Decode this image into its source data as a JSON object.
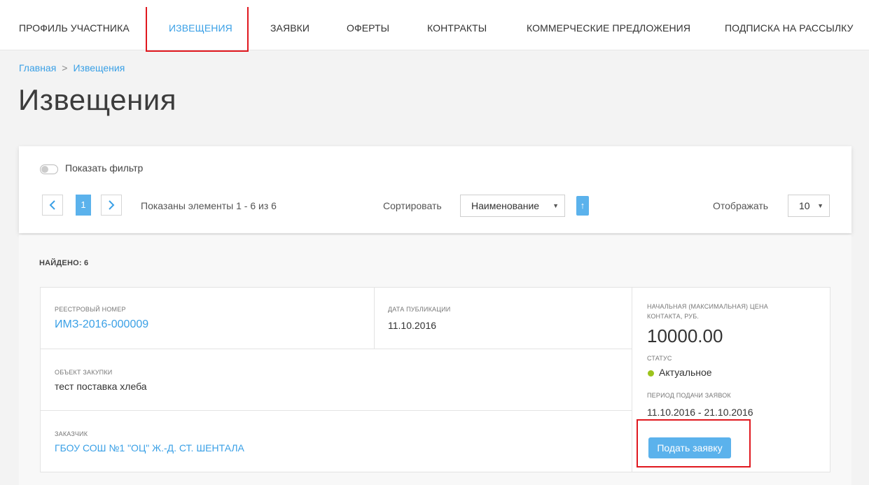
{
  "nav": {
    "items": [
      {
        "label": "ПРОФИЛЬ УЧАСТНИКА"
      },
      {
        "label": "ИЗВЕЩЕНИЯ"
      },
      {
        "label": "ЗАЯВКИ"
      },
      {
        "label": "ОФЕРТЫ"
      },
      {
        "label": "КОНТРАКТЫ"
      },
      {
        "label": "КОММЕРЧЕСКИЕ ПРЕДЛОЖЕНИЯ"
      },
      {
        "label": "ПОДПИСКА НА РАССЫЛКУ"
      }
    ],
    "active_index": 1
  },
  "breadcrumb": {
    "home": "Главная",
    "separator": ">",
    "current": "Извещения"
  },
  "page_title": "Извещения",
  "filter": {
    "toggle_label": "Показать фильтр",
    "toggle_on": false
  },
  "pager": {
    "prev_icon": "chevron-left-icon",
    "next_icon": "chevron-right-icon",
    "current_page": "1",
    "shown_text": "Показаны элементы 1 - 6 из 6"
  },
  "sort": {
    "label": "Сортировать",
    "selected": "Наименование",
    "direction_icon": "arrow-up-icon"
  },
  "display": {
    "label": "Отображать",
    "selected": "10"
  },
  "results": {
    "found_text": "НАЙДЕНО: 6",
    "items": [
      {
        "registry_label": "РЕЕСТРОВЫЙ НОМЕР",
        "registry_number": "ИМЗ-2016-000009",
        "pub_date_label": "ДАТА ПУБЛИКАЦИИ",
        "pub_date": "11.10.2016",
        "object_label": "ОБЪЕКТ ЗАКУПКИ",
        "object": "тест поставка хлеба",
        "customer_label": "ЗАКАЗЧИК",
        "customer": "ГБОУ СОШ №1 \"ОЦ\" Ж.-Д. СТ. ШЕНТАЛА",
        "price_label_line1": "НАЧАЛЬНАЯ (МАКСИМАЛЬНАЯ) ЦЕНА",
        "price_label_line2": "КОНТАКТА, РУБ.",
        "price": "10000.00",
        "status_label": "СТАТУС",
        "status": "Актуальное",
        "status_color": "#9cc31c",
        "period_label": "ПЕРИОД ПОДАЧИ ЗАЯВОК",
        "period": "11.10.2016 - 21.10.2016",
        "submit_label": "Подать заявку"
      }
    ]
  },
  "colors": {
    "accent": "#3aa0e6",
    "button": "#5bb2ec",
    "highlight": "#e0181f"
  }
}
